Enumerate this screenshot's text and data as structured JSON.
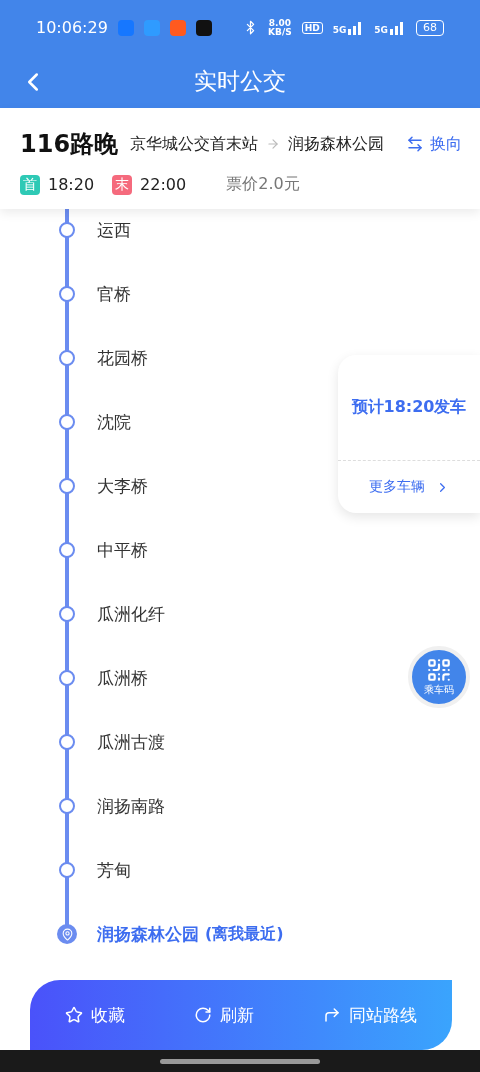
{
  "status_bar": {
    "time": "10:06:29",
    "net_speed": "8.00",
    "net_unit": "KB/S",
    "hd": "HD",
    "signal_1": "5G",
    "signal_2": "5G",
    "battery": "68"
  },
  "header": {
    "title": "实时公交"
  },
  "route": {
    "name": "116路晚",
    "from": "京华城公交首末站",
    "to": "润扬森林公园",
    "switch": "换向",
    "first_label": "首",
    "first_time": "18:20",
    "last_label": "末",
    "last_time": "22:00",
    "fare": "票价2.0元"
  },
  "stops": [
    {
      "name": "运西",
      "kind": "normal"
    },
    {
      "name": "官桥",
      "kind": "normal"
    },
    {
      "name": "花园桥",
      "kind": "normal"
    },
    {
      "name": "沈院",
      "kind": "normal"
    },
    {
      "name": "大李桥",
      "kind": "normal"
    },
    {
      "name": "中平桥",
      "kind": "normal"
    },
    {
      "name": "瓜洲化纤",
      "kind": "normal"
    },
    {
      "name": "瓜洲桥",
      "kind": "normal"
    },
    {
      "name": "瓜洲古渡",
      "kind": "normal"
    },
    {
      "name": "润扬南路",
      "kind": "normal"
    },
    {
      "name": "芳甸",
      "kind": "normal"
    },
    {
      "name": "润扬森林公园",
      "kind": "nearest",
      "note": "(离我最近)"
    }
  ],
  "departure_card": {
    "eta": "预计18:20发车",
    "more": "更多车辆"
  },
  "qr_button": {
    "label": "乘车码"
  },
  "bottom_bar": {
    "actions": [
      {
        "label": "收藏",
        "kind": "favorite"
      },
      {
        "label": "刷新",
        "kind": "refresh"
      },
      {
        "label": "同站路线",
        "kind": "routes"
      }
    ]
  }
}
